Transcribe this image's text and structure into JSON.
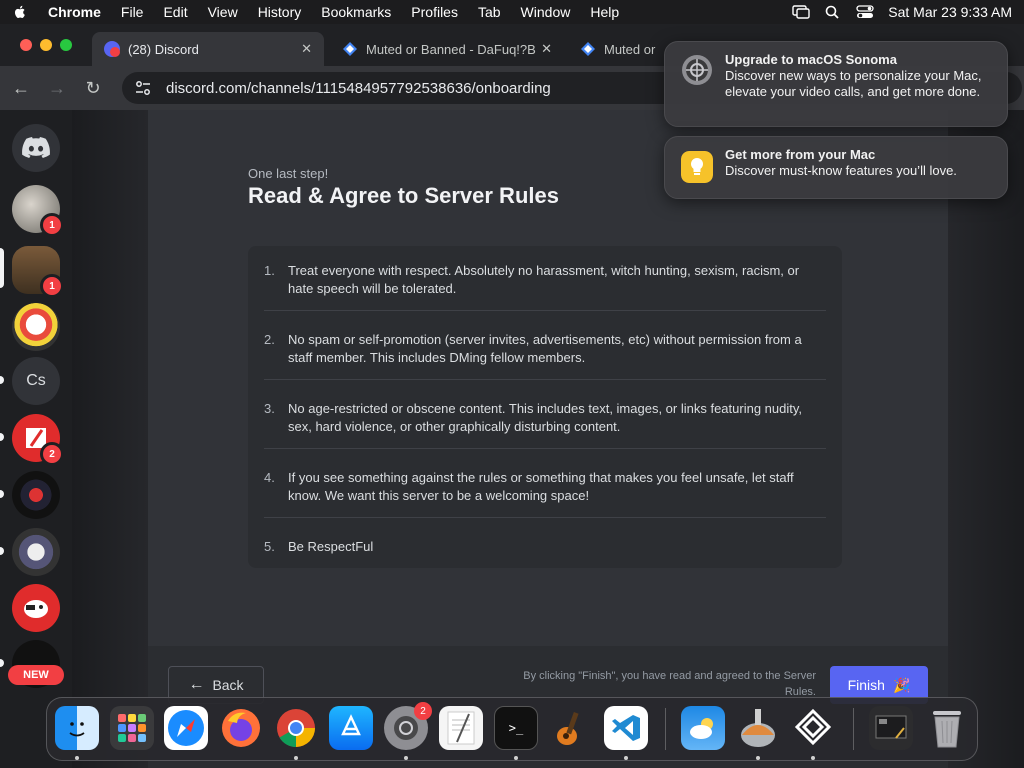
{
  "menubar": {
    "app_name": "Chrome",
    "menus": [
      "File",
      "Edit",
      "View",
      "History",
      "Bookmarks",
      "Profiles",
      "Tab",
      "Window",
      "Help"
    ],
    "datetime": "Sat Mar 23  9:33 AM"
  },
  "browser": {
    "tabs": [
      {
        "label": "(28) Discord",
        "favicon": "discord-icon",
        "favicon_badge": "28",
        "active": true
      },
      {
        "label": "Muted or Banned - DaFuq!?B",
        "favicon": "dafuq-icon",
        "active": false
      },
      {
        "label": "Muted or Ba",
        "favicon": "dafuq-icon",
        "active": false
      }
    ],
    "url": "discord.com/channels/1115484957792538636/onboarding"
  },
  "sidebar": {
    "guilds": [
      {
        "name": "discord-home",
        "badge": null
      },
      {
        "name": "guild-1",
        "badge": "1"
      },
      {
        "name": "guild-2",
        "badge": "1"
      },
      {
        "name": "guild-3",
        "badge": null
      },
      {
        "name": "guild-cs",
        "label": "Cs",
        "badge": null
      },
      {
        "name": "guild-5",
        "badge": "2"
      },
      {
        "name": "guild-6",
        "badge": null
      },
      {
        "name": "guild-7",
        "badge": null
      },
      {
        "name": "guild-8",
        "badge": null
      },
      {
        "name": "guild-9",
        "badge": null
      }
    ],
    "new_badge": "NEW"
  },
  "onboarding": {
    "eyebrow": "One last step!",
    "title": "Read & Agree to Server Rules",
    "rules": [
      {
        "num": "1.",
        "text": "Treat everyone with respect. Absolutely no harassment, witch hunting, sexism, racism, or hate speech will be tolerated."
      },
      {
        "num": "2.",
        "text": "No spam or self-promotion (server invites, advertisements, etc) without permission from a staff member. This includes DMing fellow members."
      },
      {
        "num": "3.",
        "text": "No age-restricted or obscene content. This includes text, images, or links featuring nudity, sex, hard violence, or other graphically disturbing content."
      },
      {
        "num": "4.",
        "text": "If you see something against the rules or something that makes you feel unsafe, let staff know. We want this server to be a welcoming space!"
      },
      {
        "num": "5.",
        "text": "Be RespectFul"
      }
    ],
    "back_label": "Back",
    "consent_text": "By clicking \"Finish\", you have read and agreed to the Server Rules.",
    "finish_label": "Finish"
  },
  "notifications": [
    {
      "title": "Upgrade to macOS Sonoma",
      "body": "Discover new ways to personalize your Mac, elevate your video calls, and get more done.",
      "icon": "system-settings-icon"
    },
    {
      "title": "Get more from your Mac",
      "body": "Discover must-know features you’ll love.",
      "icon": "tips-lightbulb-icon"
    }
  ],
  "dock": {
    "apps": [
      "finder",
      "launchpad",
      "safari",
      "firefox",
      "chrome",
      "app-store",
      "system-settings",
      "textedit",
      "terminal",
      "garageband",
      "vscode",
      "weather",
      "migration-assistant",
      "obs",
      "screenshot",
      "trash"
    ],
    "system_settings_badge": "2"
  },
  "colors": {
    "discord_blurple": "#5865f2",
    "badge_red": "#f23f43",
    "modal_bg": "#313338"
  }
}
